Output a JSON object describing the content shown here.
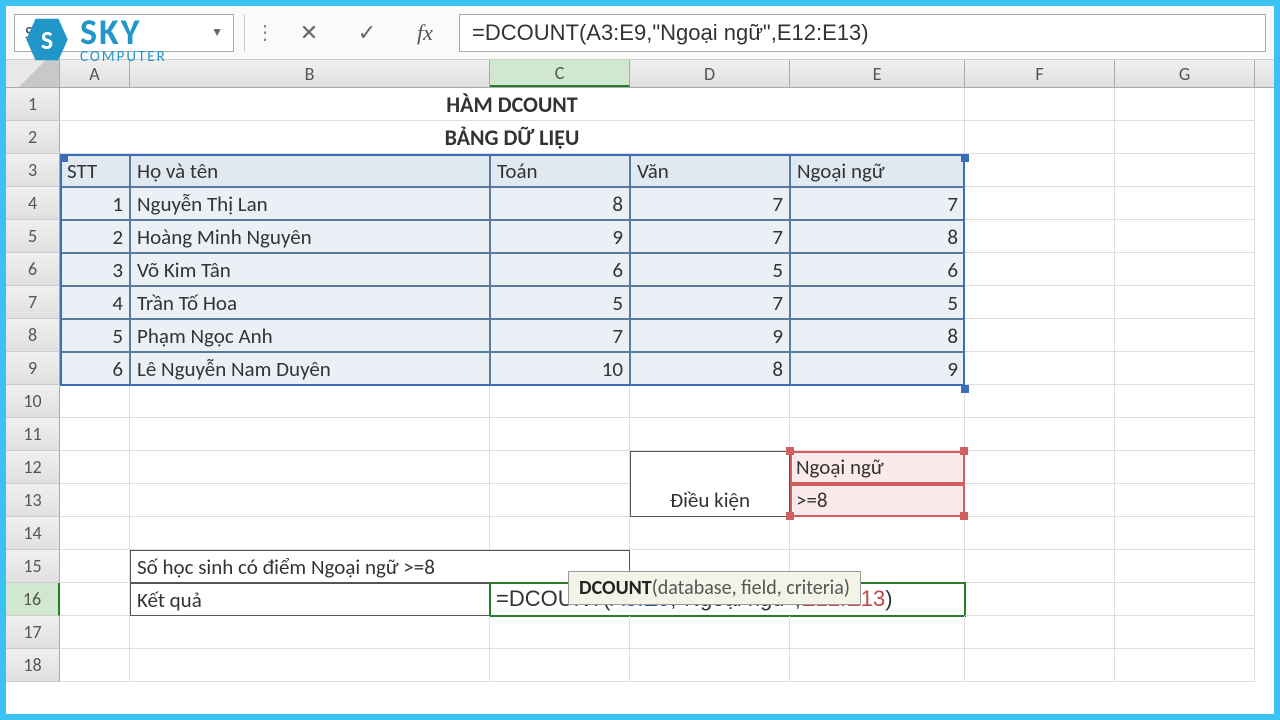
{
  "namebox": "SUM",
  "formula_bar": "=DCOUNT(A3:E9,\"Ngoại ngữ\",E12:E13)",
  "columns": [
    "A",
    "B",
    "C",
    "D",
    "E",
    "F",
    "G"
  ],
  "row_numbers": [
    1,
    2,
    3,
    4,
    5,
    6,
    7,
    8,
    9,
    10,
    11,
    12,
    13,
    14,
    15,
    16,
    17,
    18
  ],
  "title1": "HÀM DCOUNT",
  "title2": "BẢNG DỮ LIỆU",
  "headers": {
    "stt": "STT",
    "name": "Họ và tên",
    "math": "Toán",
    "lit": "Văn",
    "lang": "Ngoại ngữ"
  },
  "data": [
    {
      "stt": 1,
      "name": "Nguyễn Thị Lan",
      "math": 8,
      "lit": 7,
      "lang": 7
    },
    {
      "stt": 2,
      "name": "Hoàng Minh Nguyên",
      "math": 9,
      "lit": 7,
      "lang": 8
    },
    {
      "stt": 3,
      "name": "Võ Kim Tân",
      "math": 6,
      "lit": 5,
      "lang": 6
    },
    {
      "stt": 4,
      "name": "Trần Tố Hoa",
      "math": 5,
      "lit": 7,
      "lang": 5
    },
    {
      "stt": 5,
      "name": "Phạm Ngọc Anh",
      "math": 7,
      "lit": 9,
      "lang": 8
    },
    {
      "stt": 6,
      "name": "Lê Nguyễn Nam Duyên",
      "math": 10,
      "lit": 8,
      "lang": 9
    }
  ],
  "criteria": {
    "label": "Điều kiện",
    "header": "Ngoại ngữ",
    "value": ">=8"
  },
  "question": "Số học sinh có điểm Ngoại ngữ  >=8",
  "result_label": "Kết quả",
  "formula_pre": "=DCOUNT(",
  "formula_db": "A3:E9",
  "formula_sep1": ",\"Ngoại ngữ\",",
  "formula_crit": "E12:E13",
  "formula_post": ")",
  "tooltip": {
    "fn": "DCOUNT",
    "args": "(database, field, criteria)"
  },
  "logo": {
    "sky": "SKY",
    "sub": "COMPUTER",
    "icon": "S"
  }
}
